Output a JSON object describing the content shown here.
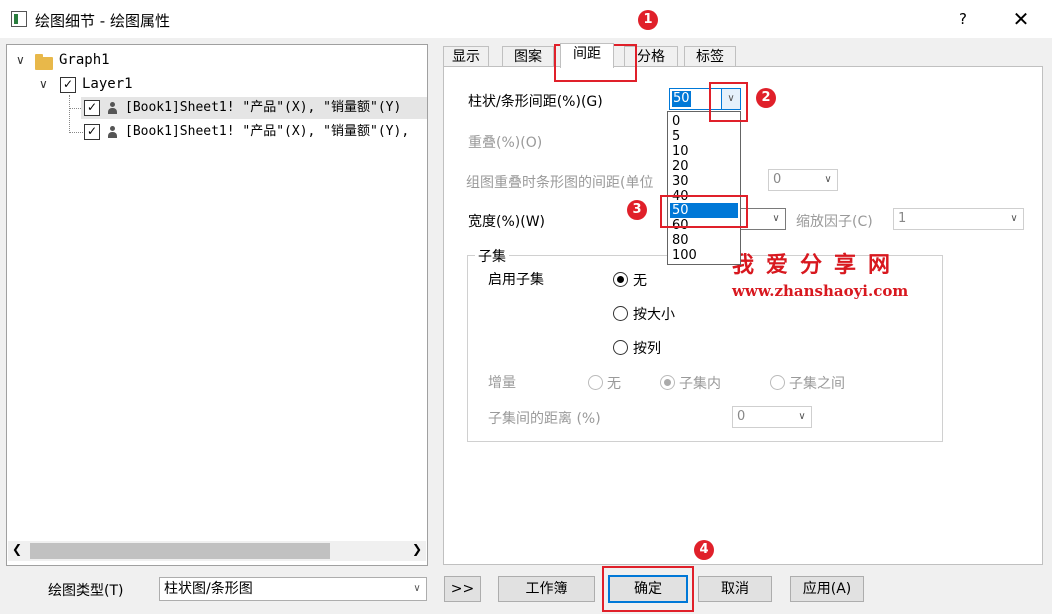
{
  "window": {
    "title": "绘图细节 - 绘图属性",
    "help_label": "?",
    "close_label": "✕"
  },
  "tree": {
    "graph": "Graph1",
    "layer": "Layer1",
    "plots": [
      "[Book1]Sheet1! \"产品\"(X), \"销量额\"(Y)",
      "[Book1]Sheet1! \"产品\"(X), \"销量额\"(Y),"
    ]
  },
  "tabs": [
    "显示",
    "图案",
    "间距",
    "分格",
    "标签"
  ],
  "active_tab": "间距",
  "spacing": {
    "gap_label": "柱状/条形间距(%)(G)",
    "gap_value": "50",
    "gap_options": [
      "0",
      "5",
      "10",
      "20",
      "30",
      "40",
      "50",
      "60",
      "80",
      "100"
    ],
    "overlap_label": "重叠(%)(O)",
    "group_gap_label": "组图重叠时条形图的间距(单位",
    "group_gap_value": "0",
    "width_label": "宽度(%)(W)",
    "scale_label": "缩放因子(C)",
    "scale_value": "1"
  },
  "subset": {
    "group_title": "子集",
    "enable_label": "启用子集",
    "options": [
      "无",
      "按大小",
      "按列"
    ],
    "selected": "无",
    "increment_label": "增量",
    "increment_options": [
      "无",
      "子集内",
      "子集之间"
    ],
    "increment_selected": "子集内",
    "distance_label": "子集间的距离 (%)",
    "distance_value": "0"
  },
  "watermark": {
    "title": "我爱分享网",
    "url": "www.zhanshaoyi.com"
  },
  "annotations": [
    "1",
    "2",
    "3",
    "4"
  ],
  "footer": {
    "plot_type_label": "绘图类型(T)",
    "plot_type_value": "柱状图/条形图",
    "expand_label": ">>",
    "workbook_label": "工作簿",
    "ok_label": "确定",
    "cancel_label": "取消",
    "apply_label": "应用(A)"
  },
  "colors": {
    "accent": "#0078d7",
    "annotation": "#e0202a"
  }
}
